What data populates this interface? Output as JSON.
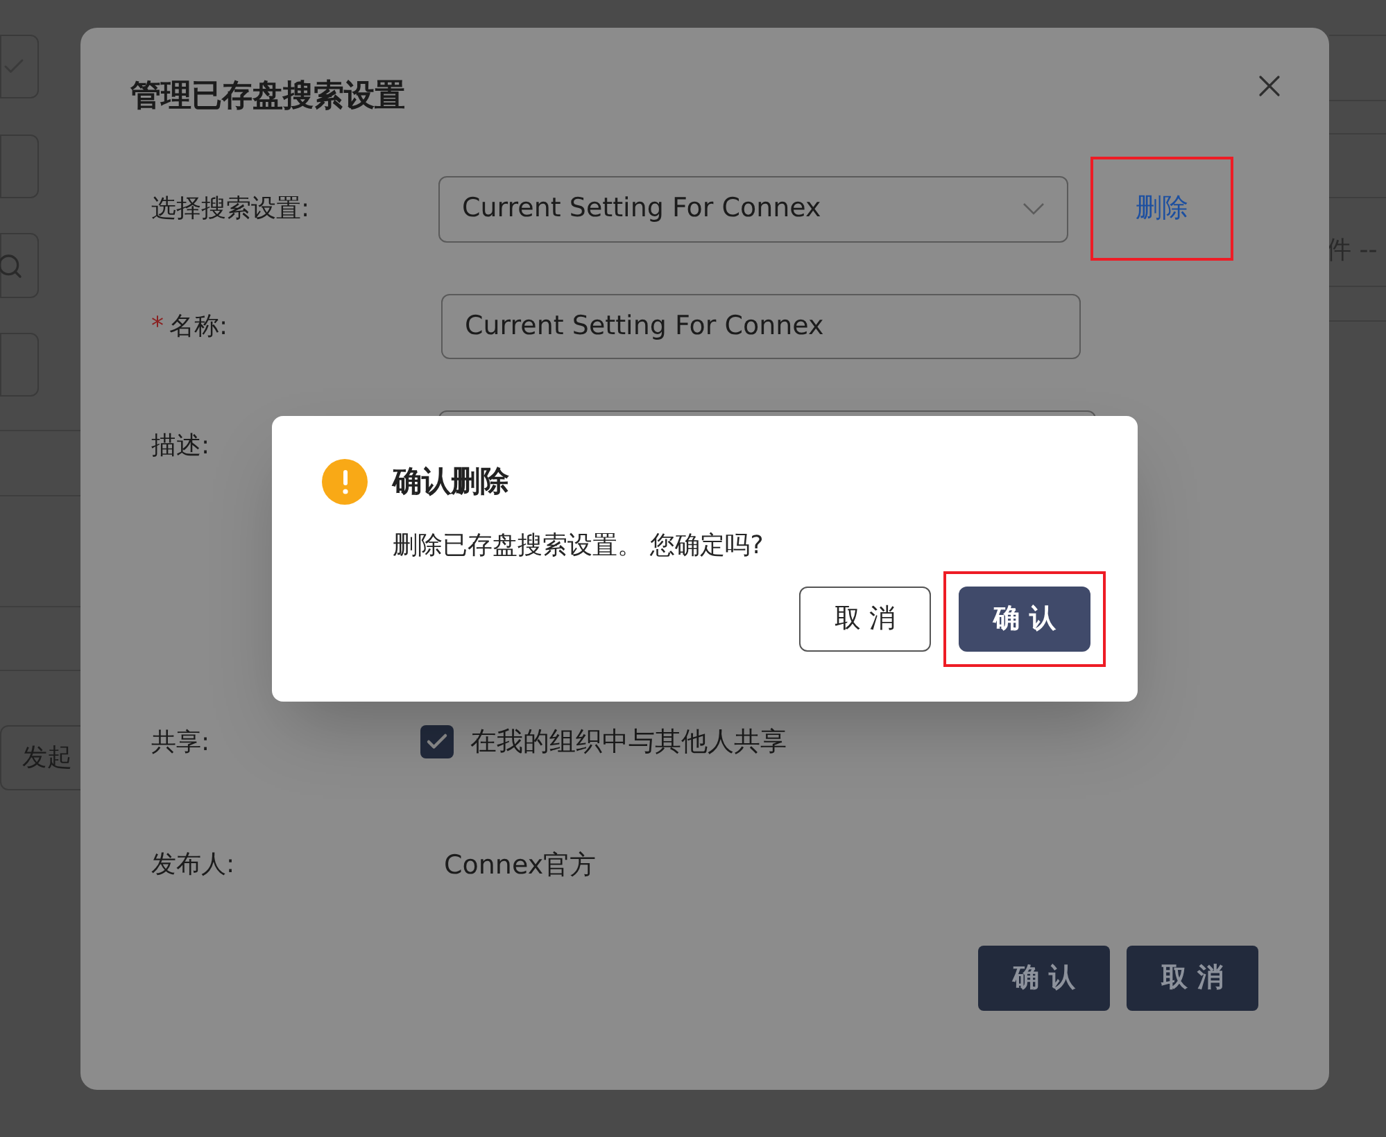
{
  "background": {
    "left_button": "发起",
    "right_text": "件 --"
  },
  "dialog": {
    "title": "管理已存盘搜索设置",
    "fields": [
      {
        "kind": "select",
        "label": "选择搜索设置:",
        "value": "Current Setting For Connex"
      },
      {
        "kind": "input",
        "label": "名称:",
        "value": "Current Setting For Connex",
        "required_mark": "*"
      },
      {
        "kind": "textarea",
        "label": "描述:"
      },
      {
        "kind": "checkbox",
        "label": "共享:",
        "text": "在我的组织中与其他人共享",
        "checked": true
      },
      {
        "kind": "text",
        "label": "发布人:",
        "value": "Connex官方"
      }
    ],
    "delete_link": {
      "label": "删除",
      "highlighted": true
    },
    "buttons": [
      {
        "label": "确 认"
      },
      {
        "label": "取 消"
      }
    ]
  },
  "confirm": {
    "title": "确认删除",
    "message": "删除已存盘搜索设置。 您确定吗?",
    "buttons": [
      {
        "label": "取 消",
        "kind": "secondary",
        "highlighted": false
      },
      {
        "label": "确 认",
        "kind": "primary",
        "highlighted": true
      }
    ]
  }
}
